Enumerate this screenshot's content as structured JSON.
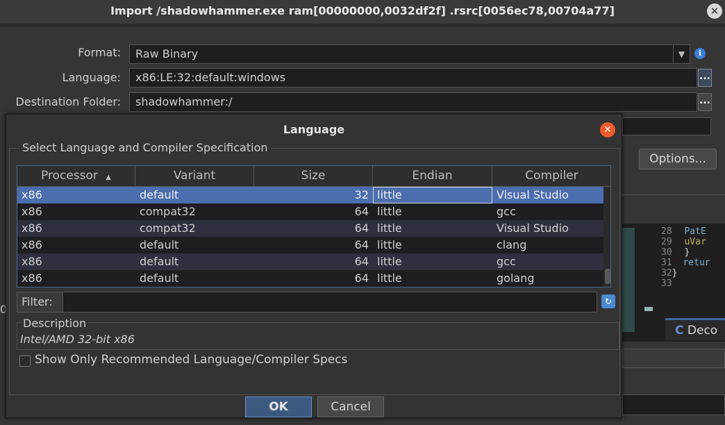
{
  "import_dialog": {
    "title": "Import /shadowhammer.exe ram[00000000,0032df2f] .rsrc[0056ec78,00704a77]",
    "close_label": "✕",
    "format_label": "Format:",
    "format_value": "Raw Binary",
    "language_label": "Language:",
    "language_value": "x86:LE:32:default:windows",
    "destination_label": "Destination Folder:",
    "destination_value": "shadowhammer:/",
    "browse_label": "...",
    "info_icon": "ℹ",
    "options_label": "Options...",
    "partial_left_text": "0"
  },
  "code_panel": {
    "lines": [
      {
        "num": "28",
        "code": "  PatE"
      },
      {
        "num": "29",
        "code": "  uVar"
      },
      {
        "num": "30",
        "code": "}"
      },
      {
        "num": "31",
        "code": "retur"
      },
      {
        "num": "32",
        "code": "}"
      },
      {
        "num": "33",
        "code": ""
      }
    ],
    "tab_label": "Deco",
    "tab_icon": "C"
  },
  "language_dialog": {
    "title": "Language",
    "close_label": "✕",
    "group_label": "Select Language and Compiler Specification",
    "columns": [
      "Processor",
      "Variant",
      "Size",
      "Endian",
      "Compiler"
    ],
    "sort_icon": "▲",
    "rows": [
      {
        "processor": "x86",
        "variant": "default",
        "size": "32",
        "endian": "little",
        "compiler": "Visual Studio",
        "selected": true
      },
      {
        "processor": "x86",
        "variant": "compat32",
        "size": "64",
        "endian": "little",
        "compiler": "gcc",
        "selected": false
      },
      {
        "processor": "x86",
        "variant": "compat32",
        "size": "64",
        "endian": "little",
        "compiler": "Visual Studio",
        "selected": false
      },
      {
        "processor": "x86",
        "variant": "default",
        "size": "64",
        "endian": "little",
        "compiler": "clang",
        "selected": false
      },
      {
        "processor": "x86",
        "variant": "default",
        "size": "64",
        "endian": "little",
        "compiler": "gcc",
        "selected": false
      },
      {
        "processor": "x86",
        "variant": "default",
        "size": "64",
        "endian": "little",
        "compiler": "golang",
        "selected": false
      }
    ],
    "filter_label": "Filter:",
    "filter_value": "",
    "description_label": "Description",
    "description_text": "Intel/AMD 32-bit x86",
    "recommended_label": "Show Only Recommended Language/Compiler Specs",
    "recommended_checked": false,
    "ok_label": "OK",
    "cancel_label": "Cancel"
  }
}
